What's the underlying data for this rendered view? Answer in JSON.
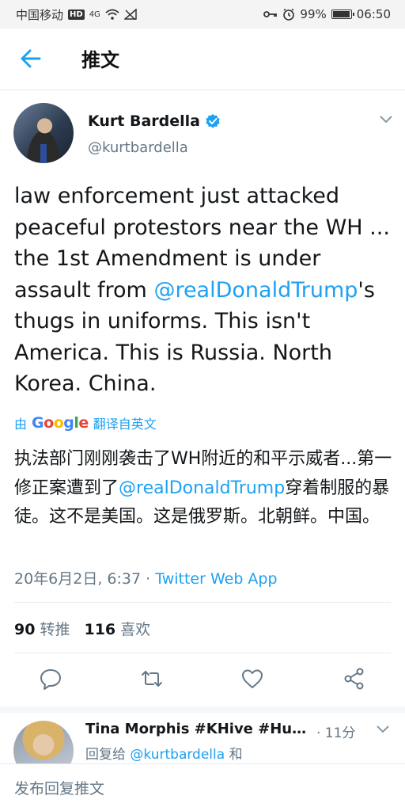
{
  "status_bar": {
    "carrier": "中国移动",
    "hd": "HD",
    "network": "4G",
    "battery_percent": "99%",
    "battery_level": 0.99,
    "time": "06:50"
  },
  "header": {
    "title": "推文"
  },
  "tweet": {
    "display_name": "Kurt Bardella",
    "handle": "@kurtbardella",
    "text_part1": "law enforcement just attacked peaceful protestors near the WH ... the 1st Amendment is under assault from ",
    "mention": "@realDonaldTrump",
    "text_part2": "'s thugs in uniforms. This isn't America. This is Russia. North Korea. China.",
    "translate_by": "由",
    "translate_provider": "Google",
    "translate_label": "翻译自英文",
    "translated_part1": "执法部门刚刚袭击了WH附近的和平示威者...第一修正案遭到了",
    "translated_mention": "@realDonaldTrump",
    "translated_part2": "穿着制服的暴徒。这不是美国。这是俄罗斯。北朝鲜。中国。",
    "timestamp": "20年6月2日, 6:37",
    "separator": " · ",
    "source": "Twitter Web App",
    "retweet_count": "90",
    "retweet_label": "转推",
    "like_count": "116",
    "like_label": "喜欢"
  },
  "reply": {
    "name": "Tina Morphis #KHive #Hum...",
    "time": "· 11分",
    "reply_to_prefix": "回复给 ",
    "reply_to_handle": "@kurtbardella",
    "reply_to_suffix": " 和"
  },
  "compose": {
    "placeholder": "发布回复推文"
  },
  "colors": {
    "accent": "#1da1f2",
    "text": "#14171a",
    "secondary": "#657786"
  }
}
